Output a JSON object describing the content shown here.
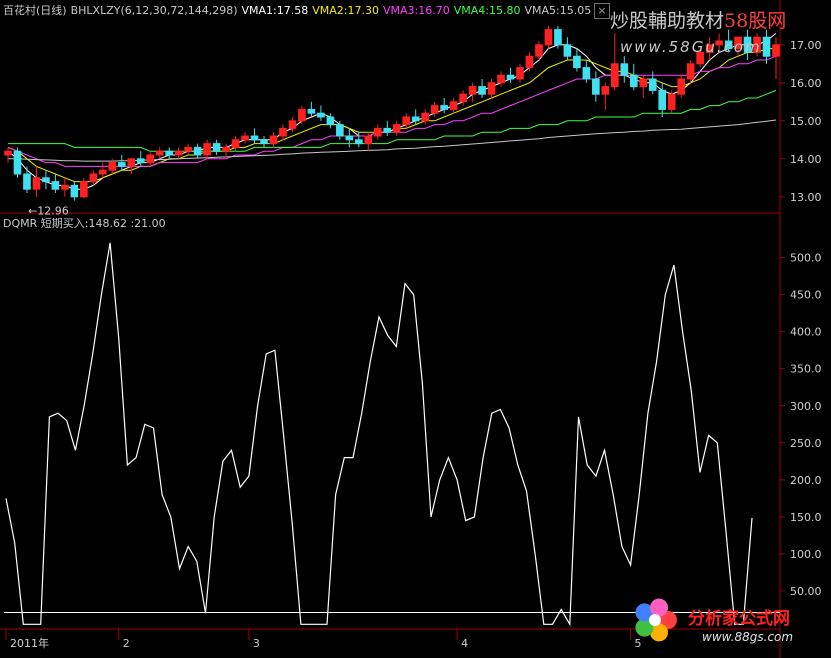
{
  "header": {
    "stock_name": "百花村(日线)",
    "indicator": "BHLXLZY(6,12,30,72,144,298)",
    "vma1": "VMA1:17.58",
    "vma2": "VMA2:17.30",
    "vma3": "VMA3:16.70",
    "vma4": "VMA4:15.80",
    "vma5": "VMA5:15.05",
    "close_symbol": "×"
  },
  "watermark": {
    "text_cn": "炒股輔助教材",
    "text_site": "58股网",
    "url": "www.58Gu.com"
  },
  "low_marker": "←12.96",
  "indicator_header": "DQMR 短期买入:148.62 :21.00",
  "brand": {
    "name": "分析家公式网",
    "url": "www.88gs.com"
  },
  "colors": {
    "background": "#000000",
    "axis": "#a00000",
    "up_candle": "#ff2020",
    "down_candle": "#40e0f0",
    "vma1": "#ffffff",
    "vma2": "#f0f000",
    "vma3": "#ff40ff",
    "vma4": "#40ff40",
    "vma5": "#c8c8c8",
    "dqmr_line": "#ffffff",
    "ref_line": "#ffffff"
  },
  "chart_data": [
    {
      "type": "candlestick",
      "title": "百花村(日线)",
      "yticks": [
        "13.00",
        "14.00",
        "15.00",
        "16.00",
        "17.00"
      ],
      "ylim": [
        12.6,
        17.6
      ],
      "low_marker_value": 12.96,
      "candles_ohlc": [
        [
          14.1,
          14.3,
          13.9,
          14.2
        ],
        [
          14.2,
          14.3,
          13.5,
          13.6
        ],
        [
          13.6,
          13.8,
          13.1,
          13.2
        ],
        [
          13.2,
          13.8,
          13.0,
          13.5
        ],
        [
          13.5,
          13.7,
          13.2,
          13.4
        ],
        [
          13.4,
          13.6,
          13.1,
          13.2
        ],
        [
          13.2,
          13.5,
          13.0,
          13.3
        ],
        [
          13.3,
          13.4,
          12.9,
          13.0
        ],
        [
          13.0,
          13.5,
          12.96,
          13.4
        ],
        [
          13.4,
          13.7,
          13.3,
          13.6
        ],
        [
          13.6,
          13.9,
          13.5,
          13.7
        ],
        [
          13.7,
          14.0,
          13.6,
          13.9
        ],
        [
          13.9,
          14.1,
          13.7,
          13.8
        ],
        [
          13.8,
          14.0,
          13.6,
          14.0
        ],
        [
          14.0,
          14.2,
          13.8,
          13.9
        ],
        [
          13.9,
          14.2,
          13.8,
          14.1
        ],
        [
          14.1,
          14.3,
          14.0,
          14.2
        ],
        [
          14.2,
          14.3,
          14.0,
          14.1
        ],
        [
          14.1,
          14.3,
          14.0,
          14.2
        ],
        [
          14.2,
          14.4,
          14.1,
          14.3
        ],
        [
          14.3,
          14.4,
          14.0,
          14.1
        ],
        [
          14.1,
          14.5,
          14.0,
          14.4
        ],
        [
          14.4,
          14.5,
          14.1,
          14.2
        ],
        [
          14.2,
          14.4,
          14.0,
          14.3
        ],
        [
          14.3,
          14.6,
          14.2,
          14.5
        ],
        [
          14.5,
          14.7,
          14.4,
          14.6
        ],
        [
          14.6,
          14.8,
          14.4,
          14.5
        ],
        [
          14.5,
          14.6,
          14.3,
          14.4
        ],
        [
          14.4,
          14.7,
          14.3,
          14.6
        ],
        [
          14.6,
          14.9,
          14.5,
          14.8
        ],
        [
          14.8,
          15.1,
          14.7,
          15.0
        ],
        [
          15.0,
          15.4,
          14.9,
          15.3
        ],
        [
          15.3,
          15.5,
          15.1,
          15.2
        ],
        [
          15.2,
          15.4,
          15.0,
          15.1
        ],
        [
          15.1,
          15.2,
          14.8,
          14.9
        ],
        [
          14.9,
          15.0,
          14.5,
          14.6
        ],
        [
          14.6,
          14.8,
          14.3,
          14.5
        ],
        [
          14.5,
          14.7,
          14.3,
          14.4
        ],
        [
          14.4,
          14.7,
          14.2,
          14.6
        ],
        [
          14.6,
          14.9,
          14.5,
          14.8
        ],
        [
          14.8,
          15.0,
          14.6,
          14.7
        ],
        [
          14.7,
          15.0,
          14.6,
          14.9
        ],
        [
          14.9,
          15.2,
          14.8,
          15.1
        ],
        [
          15.1,
          15.3,
          14.9,
          15.0
        ],
        [
          15.0,
          15.3,
          14.9,
          15.2
        ],
        [
          15.2,
          15.5,
          15.1,
          15.4
        ],
        [
          15.4,
          15.6,
          15.2,
          15.3
        ],
        [
          15.3,
          15.6,
          15.2,
          15.5
        ],
        [
          15.5,
          15.8,
          15.4,
          15.7
        ],
        [
          15.7,
          16.0,
          15.5,
          15.9
        ],
        [
          15.9,
          16.1,
          15.6,
          15.7
        ],
        [
          15.7,
          16.1,
          15.6,
          16.0
        ],
        [
          16.0,
          16.3,
          15.9,
          16.2
        ],
        [
          16.2,
          16.4,
          16.0,
          16.1
        ],
        [
          16.1,
          16.5,
          16.0,
          16.4
        ],
        [
          16.4,
          16.8,
          16.3,
          16.7
        ],
        [
          16.7,
          17.1,
          16.6,
          17.0
        ],
        [
          17.0,
          17.5,
          16.9,
          17.4
        ],
        [
          17.4,
          17.5,
          16.9,
          17.0
        ],
        [
          17.0,
          17.2,
          16.6,
          16.7
        ],
        [
          16.7,
          16.9,
          16.3,
          16.4
        ],
        [
          16.4,
          16.6,
          16.0,
          16.1
        ],
        [
          16.1,
          16.3,
          15.5,
          15.7
        ],
        [
          15.7,
          16.0,
          15.3,
          15.9
        ],
        [
          15.9,
          17.3,
          15.8,
          16.5
        ],
        [
          16.5,
          16.7,
          16.0,
          16.2
        ],
        [
          16.2,
          16.5,
          15.8,
          15.9
        ],
        [
          15.9,
          16.2,
          15.6,
          16.1
        ],
        [
          16.1,
          16.3,
          15.7,
          15.8
        ],
        [
          15.8,
          16.0,
          15.1,
          15.3
        ],
        [
          15.3,
          15.8,
          15.2,
          15.7
        ],
        [
          15.7,
          16.2,
          15.6,
          16.1
        ],
        [
          16.1,
          16.6,
          16.0,
          16.5
        ],
        [
          16.5,
          16.9,
          16.4,
          16.8
        ],
        [
          16.8,
          17.2,
          16.6,
          17.0
        ],
        [
          17.0,
          17.3,
          16.8,
          17.1
        ],
        [
          17.1,
          17.4,
          16.8,
          16.9
        ],
        [
          16.9,
          17.2,
          16.7,
          17.2
        ],
        [
          17.2,
          17.4,
          16.6,
          16.8
        ],
        [
          16.8,
          17.3,
          16.7,
          17.2
        ],
        [
          17.2,
          17.4,
          16.5,
          16.7
        ],
        [
          16.7,
          17.2,
          16.1,
          17.0
        ]
      ],
      "series": [
        {
          "name": "VMA1",
          "values": [
            14.2,
            14.0,
            13.7,
            13.5,
            13.4,
            13.3,
            13.3,
            13.2,
            13.2,
            13.3,
            13.5,
            13.6,
            13.7,
            13.8,
            13.9,
            13.9,
            14.0,
            14.1,
            14.1,
            14.2,
            14.2,
            14.3,
            14.3,
            14.3,
            14.4,
            14.5,
            14.5,
            14.5,
            14.5,
            14.7,
            14.8,
            15.0,
            15.1,
            15.2,
            15.1,
            14.9,
            14.8,
            14.6,
            14.6,
            14.7,
            14.7,
            14.8,
            14.9,
            15.0,
            15.1,
            15.2,
            15.3,
            15.4,
            15.5,
            15.7,
            15.8,
            15.9,
            16.0,
            16.1,
            16.2,
            16.4,
            16.6,
            16.9,
            17.0,
            17.0,
            16.9,
            16.7,
            16.4,
            16.2,
            16.2,
            16.2,
            16.1,
            16.0,
            16.0,
            15.8,
            15.7,
            15.8,
            16.0,
            16.3,
            16.6,
            16.8,
            16.9,
            17.0,
            17.0,
            17.0,
            17.1,
            17.3
          ]
        },
        {
          "name": "VMA2",
          "values": [
            14.3,
            14.2,
            14.0,
            13.8,
            13.7,
            13.6,
            13.5,
            13.4,
            13.4,
            13.4,
            13.5,
            13.6,
            13.7,
            13.7,
            13.8,
            13.8,
            13.9,
            14.0,
            14.0,
            14.1,
            14.1,
            14.2,
            14.2,
            14.2,
            14.3,
            14.3,
            14.4,
            14.4,
            14.4,
            14.5,
            14.6,
            14.7,
            14.8,
            14.9,
            14.9,
            14.9,
            14.8,
            14.7,
            14.7,
            14.7,
            14.7,
            14.8,
            14.8,
            14.9,
            15.0,
            15.0,
            15.1,
            15.2,
            15.3,
            15.4,
            15.5,
            15.6,
            15.7,
            15.8,
            15.9,
            16.0,
            16.2,
            16.4,
            16.5,
            16.6,
            16.6,
            16.6,
            16.5,
            16.4,
            16.3,
            16.3,
            16.2,
            16.1,
            16.1,
            16.0,
            15.9,
            15.9,
            16.0,
            16.1,
            16.3,
            16.4,
            16.6,
            16.7,
            16.8,
            16.8,
            16.9,
            16.9
          ]
        },
        {
          "name": "VMA3",
          "values": [
            14.3,
            14.2,
            14.1,
            14.0,
            13.9,
            13.9,
            13.8,
            13.8,
            13.8,
            13.8,
            13.8,
            13.8,
            13.8,
            13.8,
            13.8,
            13.8,
            13.9,
            13.9,
            13.9,
            13.9,
            13.9,
            14.0,
            14.0,
            14.0,
            14.1,
            14.1,
            14.1,
            14.2,
            14.2,
            14.3,
            14.3,
            14.4,
            14.5,
            14.5,
            14.6,
            14.6,
            14.6,
            14.6,
            14.6,
            14.7,
            14.7,
            14.7,
            14.7,
            14.8,
            14.8,
            14.9,
            14.9,
            15.0,
            15.0,
            15.1,
            15.2,
            15.2,
            15.3,
            15.4,
            15.5,
            15.6,
            15.7,
            15.8,
            15.9,
            16.0,
            16.1,
            16.1,
            16.1,
            16.2,
            16.2,
            16.2,
            16.2,
            16.2,
            16.2,
            16.2,
            16.2,
            16.2,
            16.2,
            16.3,
            16.3,
            16.4,
            16.4,
            16.5,
            16.5,
            16.6,
            16.6,
            16.7
          ]
        },
        {
          "name": "VMA4",
          "values": [
            14.4,
            14.4,
            14.4,
            14.4,
            14.4,
            14.4,
            14.4,
            14.3,
            14.3,
            14.3,
            14.3,
            14.3,
            14.3,
            14.3,
            14.3,
            14.2,
            14.2,
            14.2,
            14.2,
            14.2,
            14.2,
            14.2,
            14.2,
            14.2,
            14.2,
            14.2,
            14.3,
            14.3,
            14.3,
            14.3,
            14.3,
            14.3,
            14.3,
            14.3,
            14.4,
            14.4,
            14.4,
            14.4,
            14.4,
            14.4,
            14.4,
            14.5,
            14.5,
            14.5,
            14.5,
            14.5,
            14.6,
            14.6,
            14.6,
            14.6,
            14.7,
            14.7,
            14.7,
            14.8,
            14.8,
            14.8,
            14.9,
            14.9,
            14.9,
            15.0,
            15.0,
            15.0,
            15.1,
            15.1,
            15.1,
            15.1,
            15.1,
            15.2,
            15.2,
            15.2,
            15.2,
            15.2,
            15.3,
            15.3,
            15.4,
            15.4,
            15.5,
            15.5,
            15.6,
            15.6,
            15.7,
            15.8
          ]
        },
        {
          "name": "VMA5",
          "values": [
            14.0,
            14.0,
            13.99,
            13.98,
            13.97,
            13.96,
            13.95,
            13.95,
            13.94,
            13.94,
            13.94,
            13.94,
            13.95,
            13.95,
            13.96,
            13.97,
            13.98,
            13.99,
            14.0,
            14.01,
            14.02,
            14.03,
            14.04,
            14.05,
            14.06,
            14.07,
            14.08,
            14.09,
            14.1,
            14.12,
            14.13,
            14.15,
            14.16,
            14.17,
            14.18,
            14.19,
            14.2,
            14.21,
            14.22,
            14.23,
            14.24,
            14.26,
            14.27,
            14.28,
            14.3,
            14.32,
            14.33,
            14.35,
            14.37,
            14.39,
            14.41,
            14.43,
            14.45,
            14.47,
            14.49,
            14.51,
            14.53,
            14.56,
            14.58,
            14.6,
            14.62,
            14.64,
            14.66,
            14.67,
            14.69,
            14.7,
            14.72,
            14.73,
            14.75,
            14.76,
            14.77,
            14.78,
            14.8,
            14.82,
            14.84,
            14.86,
            14.88,
            14.9,
            14.93,
            14.96,
            14.99,
            15.02
          ]
        }
      ]
    },
    {
      "type": "line",
      "title": "DQMR 短期买入:148.62 :21.00",
      "yticks": [
        "50.00",
        "100.0",
        "150.0",
        "200.0",
        "250.0",
        "300.0",
        "350.0",
        "400.0",
        "450.0",
        "500.0"
      ],
      "ylim": [
        0,
        540
      ],
      "xticks": [
        {
          "label": "2011年",
          "index": 0
        },
        {
          "label": "2",
          "index": 13
        },
        {
          "label": "3",
          "index": 28
        },
        {
          "label": "4",
          "index": 52
        },
        {
          "label": "5",
          "index": 72
        }
      ],
      "reference_value": 21.0,
      "series": [
        {
          "name": "短期买入",
          "values": [
            175,
            115,
            5,
            5,
            5,
            285,
            290,
            280,
            240,
            300,
            370,
            450,
            520,
            390,
            220,
            230,
            275,
            270,
            180,
            150,
            80,
            110,
            90,
            20,
            150,
            225,
            240,
            190,
            205,
            300,
            370,
            375,
            260,
            140,
            5,
            5,
            5,
            5,
            180,
            230,
            230,
            290,
            360,
            420,
            395,
            380,
            465,
            450,
            330,
            150,
            200,
            230,
            200,
            145,
            150,
            230,
            290,
            295,
            270,
            220,
            185,
            100,
            5,
            5,
            25,
            5,
            285,
            220,
            205,
            240,
            180,
            110,
            85,
            180,
            290,
            360,
            450,
            490,
            400,
            320,
            210,
            260,
            250,
            130,
            5,
            5,
            148.62
          ]
        }
      ]
    }
  ]
}
